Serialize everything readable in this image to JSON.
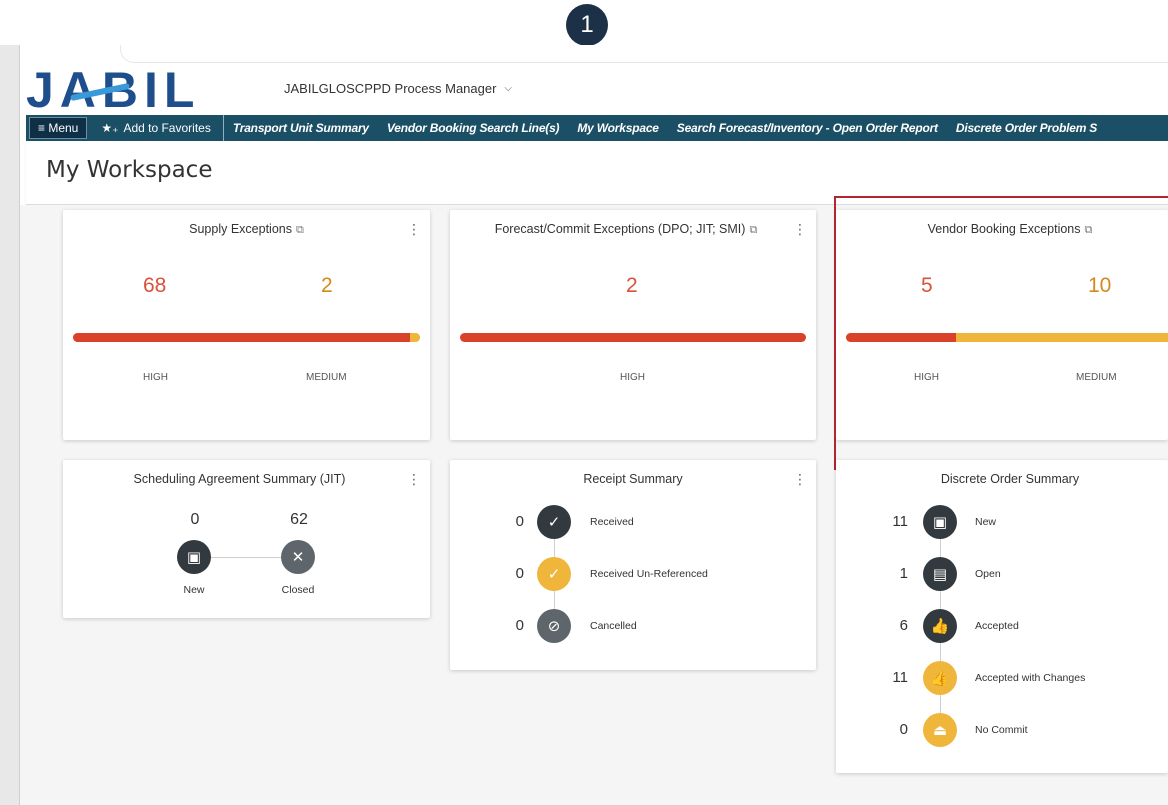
{
  "callout_number": "1",
  "logo_text": "JABIL",
  "process_manager": {
    "label": "JABILGLOSCPPD Process Manager"
  },
  "nav": {
    "menu_label": "≡ Menu",
    "favorites_label": "Add to Favorites",
    "links": [
      "Transport Unit Summary",
      "Vendor Booking Search Line(s)",
      "My Workspace",
      "Search Forecast/Inventory - Open Order Report",
      "Discrete Order Problem S"
    ]
  },
  "page_title": "My Workspace",
  "cards": {
    "supply_exceptions": {
      "title": "Supply Exceptions",
      "high_value": "68",
      "medium_value": "2",
      "high_label": "HIGH",
      "medium_label": "MEDIUM",
      "high_fraction": 0.971
    },
    "forecast_exceptions": {
      "title": "Forecast/Commit Exceptions (DPO; JIT; SMI)",
      "high_value": "2",
      "high_label": "HIGH",
      "high_fraction": 1.0
    },
    "vendor_booking_exceptions": {
      "title": "Vendor Booking Exceptions",
      "high_value": "5",
      "medium_value": "10",
      "high_label": "HIGH",
      "medium_label": "MEDIUM",
      "high_fraction": 0.333
    },
    "scheduling_agreement": {
      "title": "Scheduling Agreement Summary (JIT)",
      "new_value": "0",
      "closed_value": "62",
      "new_label": "New",
      "closed_label": "Closed"
    },
    "receipt_summary": {
      "title": "Receipt Summary",
      "items": [
        {
          "count": "0",
          "label": "Received",
          "icon": "check-icon"
        },
        {
          "count": "0",
          "label": "Received Un-Referenced",
          "icon": "check-icon"
        },
        {
          "count": "0",
          "label": "Cancelled",
          "icon": "ban-icon"
        }
      ]
    },
    "discrete_order_summary": {
      "title": "Discrete Order Summary",
      "items": [
        {
          "count": "11",
          "label": "New",
          "icon": "new-doc-icon"
        },
        {
          "count": "1",
          "label": "Open",
          "icon": "open-doc-icon"
        },
        {
          "count": "6",
          "label": "Accepted",
          "icon": "thumbs-up-icon"
        },
        {
          "count": "11",
          "label": "Accepted with Changes",
          "icon": "thumbs-up-icon"
        },
        {
          "count": "0",
          "label": "No Commit",
          "icon": "eject-icon"
        }
      ]
    }
  },
  "colors": {
    "high": "#d9412b",
    "medium": "#f0b63c",
    "nav": "#1a4f66",
    "highlight": "#b3262d"
  }
}
